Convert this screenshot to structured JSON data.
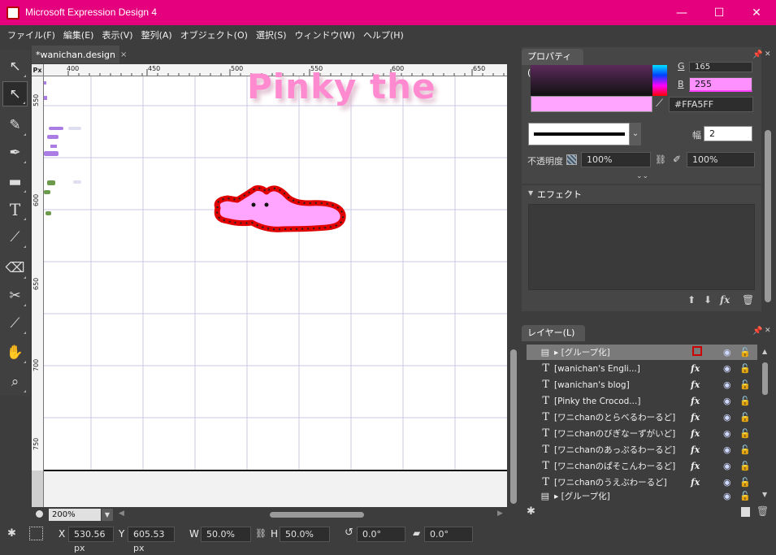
{
  "window": {
    "title": "Microsoft Expression Design 4",
    "minimize_glyph": "—",
    "maximize_glyph": "☐",
    "close_glyph": "✕"
  },
  "menu": [
    "ファイル(F)",
    "編集(E)",
    "表示(V)",
    "整列(A)",
    "オブジェクト(O)",
    "選択(S)",
    "ウィンドウ(W)",
    "ヘルプ(H)"
  ],
  "tools": [
    {
      "name": "selection-tool",
      "glyph": "↖",
      "active": false
    },
    {
      "name": "direct-selection-tool",
      "glyph": "↖",
      "active": true
    },
    {
      "name": "paintbrush-tool",
      "glyph": "✎",
      "active": false
    },
    {
      "name": "pen-tool",
      "glyph": "✒",
      "active": false
    },
    {
      "name": "rectangle-tool",
      "glyph": "▬",
      "active": false
    },
    {
      "name": "text-tool",
      "glyph": "T",
      "active": false
    },
    {
      "name": "eyedropper-tool",
      "glyph": "⟋",
      "active": false
    },
    {
      "name": "eraser-tool",
      "glyph": "⌫",
      "active": false
    },
    {
      "name": "scissors-tool",
      "glyph": "✂",
      "active": false
    },
    {
      "name": "gradient-tool",
      "glyph": "⟋",
      "active": false
    },
    {
      "name": "pan-tool",
      "glyph": "✋",
      "active": false
    },
    {
      "name": "zoom-tool",
      "glyph": "⌕",
      "active": false
    }
  ],
  "document": {
    "tab_label": "*wanichan.design",
    "close_glyph": "×",
    "ruler_unit": "Px",
    "top_ticks": [
      "400",
      "450",
      "500",
      "550",
      "600",
      "650"
    ],
    "left_ticks": [
      "550",
      "600",
      "650",
      "700",
      "750"
    ],
    "canvas_text": "Pinky the"
  },
  "zoom": {
    "value": "200%",
    "dropdown_glyph": "▼"
  },
  "status": {
    "x_label": "X",
    "x_value": "530.56 px",
    "y_label": "Y",
    "y_value": "605.53 px",
    "w_label": "W",
    "w_value": "50.0%",
    "h_label": "H",
    "h_value": "50.0%",
    "rotate_value": "0.0°",
    "skew_value": "0.0°"
  },
  "properties": {
    "header": "プロパティ(P)",
    "g_label": "G",
    "g_value": "165",
    "b_label": "B",
    "b_value": "255",
    "hex_value": "#FFA5FF",
    "width_label": "幅",
    "width_value": "2",
    "opacity_label": "不透明度",
    "fill_opacity": "100%",
    "stroke_opacity": "100%",
    "expand_glyph": "⌄⌄"
  },
  "effects": {
    "header": "エフェクト",
    "collapse_glyph": "▼"
  },
  "layers": {
    "header": "レイヤー(L)",
    "rows": [
      {
        "type": "group",
        "name": "[グループ化]",
        "selected": true
      },
      {
        "type": "text",
        "name": "[wanichan's Engli...]"
      },
      {
        "type": "text",
        "name": "[wanichan's blog]"
      },
      {
        "type": "text",
        "name": "[Pinky the Crocod...]"
      },
      {
        "type": "text",
        "name": "[ワニchanのとらべるわーるど]"
      },
      {
        "type": "text",
        "name": "[ワニchanのびぎなーずがいど]"
      },
      {
        "type": "text",
        "name": "[ワニchanのあっぷるわーるど]"
      },
      {
        "type": "text",
        "name": "[ワニchanのぱそこんわーるど]"
      },
      {
        "type": "text",
        "name": "[ワニchanのうえぶわーるど]"
      },
      {
        "type": "group",
        "name": "[グループ化]"
      }
    ],
    "text_glyph": "T",
    "fx_glyph": "fx",
    "eye_glyph": "◉",
    "lock_glyph": "🔓"
  },
  "colors": {
    "titlebar": "#e5007e",
    "fill_color": "#FFA5FF",
    "stroke_color": "#e00000",
    "canvas_text": "#ff8ad0"
  }
}
